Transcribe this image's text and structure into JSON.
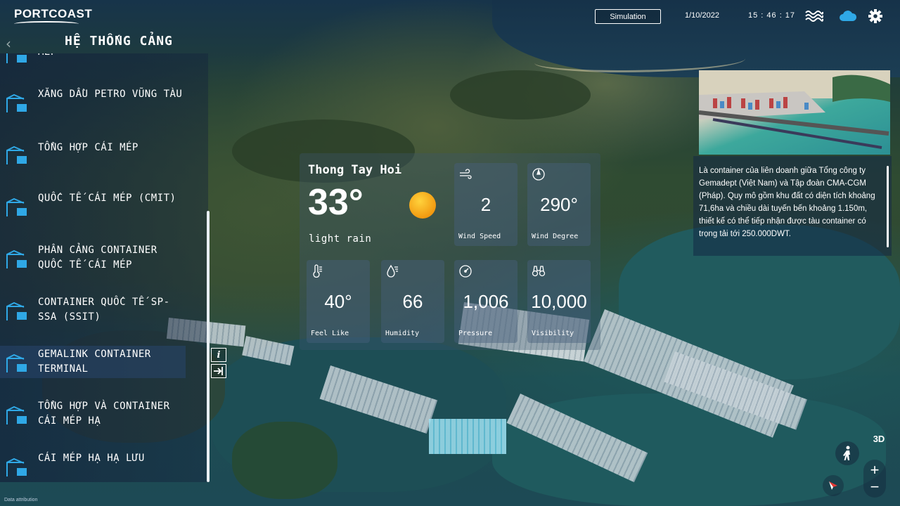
{
  "header": {
    "logo_text": "PORTCOAST",
    "page_title": "HỆ THỐNG CẢNG",
    "simulation_label": "Simulation",
    "date": "1/10/2022",
    "time": "15 : 46 : 17",
    "icons": [
      "waves-icon",
      "cloud-icon",
      "gear-icon"
    ],
    "accent_color": "#2fa8e6"
  },
  "sidebar": {
    "items": [
      {
        "label": "MÉP",
        "active": false
      },
      {
        "label": "XĂNG DẦU PETRO VŨNG TÀU",
        "active": false
      },
      {
        "label": "TỔNG HỢP CÁI MÉP",
        "active": false
      },
      {
        "label": "QUỐC TẾ CÁI MÉP (CMIT)",
        "active": false
      },
      {
        "label": "PHÂN CẢNG CONTAINER QUỐC TẾ CÁI MÉP",
        "active": false
      },
      {
        "label": "CONTAINER QUỐC TẾ SP-SSA (SSIT)",
        "active": false
      },
      {
        "label": "GEMALINK CONTAINER TERMINAL",
        "active": true
      },
      {
        "label": "TỔNG HỢP VÀ CONTAINER CÁI MÉP HẠ",
        "active": false
      },
      {
        "label": "CÁI MÉP HẠ HẠ LƯU",
        "active": false
      }
    ],
    "info_button": "i",
    "exit_icon": "exit-icon"
  },
  "weather": {
    "city": "Thong Tay Hoi",
    "temperature": "33°",
    "condition": "light rain",
    "tiles": [
      {
        "label": "Wind Speed",
        "value": "2",
        "icon": "wind-icon"
      },
      {
        "label": "Wind Degree",
        "value": "290°",
        "icon": "compass-icon"
      },
      {
        "label": "Feel Like",
        "value": "40°",
        "icon": "thermometer-icon"
      },
      {
        "label": "Humidity",
        "value": "66",
        "icon": "humidity-icon"
      },
      {
        "label": "Pressure",
        "value": "1,006",
        "icon": "pressure-gauge-icon"
      },
      {
        "label": "Visibility",
        "value": "10,000",
        "icon": "binoculars-icon"
      }
    ]
  },
  "info_panel": {
    "description": "Là container của liên doanh giữa Tổng công ty Gemadept (Việt Nam) và Tập đoàn CMA-CGM (Pháp). Quy mô gồm khu đất có diện tích khoảng 71,6ha và chiều dài tuyến bến khoảng 1.150m, thiết kế có thể tiếp nhận được tàu container có trọng tải tới 250.000DWT."
  },
  "map_controls": {
    "mode_3d": "3D",
    "zoom_in": "+",
    "zoom_out": "−"
  },
  "attribution": "Data attribution"
}
